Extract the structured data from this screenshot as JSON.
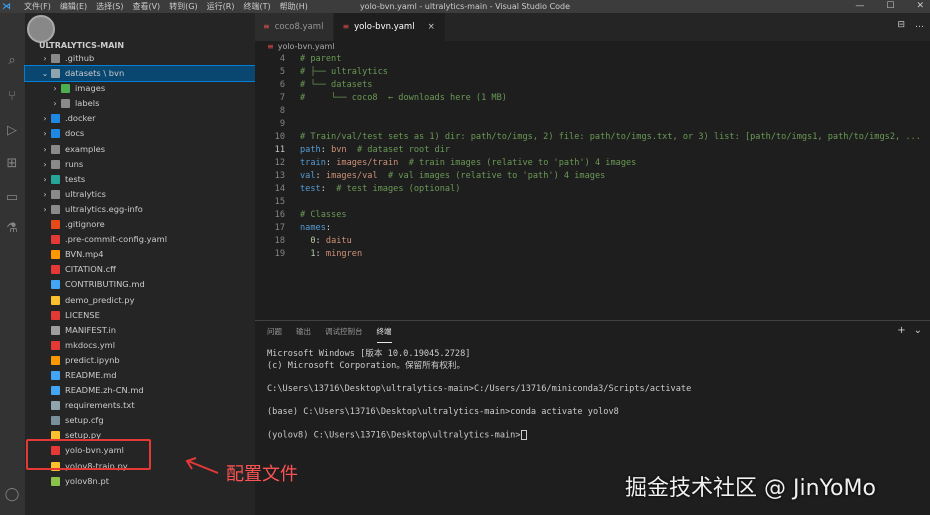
{
  "titlebar": {
    "menu": [
      "文件(F)",
      "编辑(E)",
      "选择(S)",
      "查看(V)",
      "转到(G)",
      "运行(R)",
      "终端(T)",
      "帮助(H)"
    ],
    "title": "yolo-bvn.yaml - ultralytics-main - Visual Studio Code",
    "min": "—",
    "max": "☐",
    "close": "✕"
  },
  "sidebar": {
    "title": "ULTRALYTICS-MAIN",
    "items": [
      {
        "label": ".github",
        "chev": "›",
        "icon": "#8a8a8a",
        "indent": 0
      },
      {
        "label": "datasets \\ bvn",
        "chev": "⌄",
        "icon": "#90a4ae",
        "indent": 0
      },
      {
        "label": "images",
        "chev": "›",
        "icon": "#4caf50",
        "indent": 1
      },
      {
        "label": "labels",
        "chev": "›",
        "icon": "#8a8a8a",
        "indent": 1
      },
      {
        "label": ".docker",
        "chev": "›",
        "icon": "#1e88e5",
        "indent": 0
      },
      {
        "label": "docs",
        "chev": "›",
        "icon": "#1e88e5",
        "indent": 0
      },
      {
        "label": "examples",
        "chev": "›",
        "icon": "#8a8a8a",
        "indent": 0
      },
      {
        "label": "runs",
        "chev": "›",
        "icon": "#8a8a8a",
        "indent": 0
      },
      {
        "label": "tests",
        "chev": "›",
        "icon": "#26a69a",
        "indent": 0
      },
      {
        "label": "ultralytics",
        "chev": "›",
        "icon": "#8a8a8a",
        "indent": 0
      },
      {
        "label": "ultralytics.egg-info",
        "chev": "›",
        "icon": "#8a8a8a",
        "indent": 0
      },
      {
        "label": ".gitignore",
        "chev": "",
        "icon": "#e64a19",
        "indent": 0
      },
      {
        "label": ".pre-commit-config.yaml",
        "chev": "",
        "icon": "#e53935",
        "indent": 0
      },
      {
        "label": "BVN.mp4",
        "chev": "",
        "icon": "#ff9800",
        "indent": 0
      },
      {
        "label": "CITATION.cff",
        "chev": "",
        "icon": "#e53935",
        "indent": 0
      },
      {
        "label": "CONTRIBUTING.md",
        "chev": "",
        "icon": "#42a5f5",
        "indent": 0
      },
      {
        "label": "demo_predict.py",
        "chev": "",
        "icon": "#fbc02d",
        "indent": 0
      },
      {
        "label": "LICENSE",
        "chev": "",
        "icon": "#e53935",
        "indent": 0
      },
      {
        "label": "MANIFEST.in",
        "chev": "",
        "icon": "#9e9e9e",
        "indent": 0
      },
      {
        "label": "mkdocs.yml",
        "chev": "",
        "icon": "#e53935",
        "indent": 0
      },
      {
        "label": "predict.ipynb",
        "chev": "",
        "icon": "#ff9800",
        "indent": 0
      },
      {
        "label": "README.md",
        "chev": "",
        "icon": "#42a5f5",
        "indent": 0
      },
      {
        "label": "README.zh-CN.md",
        "chev": "",
        "icon": "#42a5f5",
        "indent": 0
      },
      {
        "label": "requirements.txt",
        "chev": "",
        "icon": "#90a4ae",
        "indent": 0
      },
      {
        "label": "setup.cfg",
        "chev": "",
        "icon": "#78909c",
        "indent": 0
      },
      {
        "label": "setup.py",
        "chev": "",
        "icon": "#fbc02d",
        "indent": 0
      },
      {
        "label": "yolo-bvn.yaml",
        "chev": "",
        "icon": "#e53935",
        "indent": 0
      },
      {
        "label": "yolov8-train.py",
        "chev": "",
        "icon": "#fbc02d",
        "indent": 0
      },
      {
        "label": "yolov8n.pt",
        "chev": "",
        "icon": "#8bc34a",
        "indent": 0
      }
    ]
  },
  "tabs": [
    {
      "label": "coco8.yaml",
      "active": false
    },
    {
      "label": "yolo-bvn.yaml",
      "active": true
    }
  ],
  "tab_close": "×",
  "breadcrumb": "yolo-bvn.yaml",
  "editor_actions": [
    "⊟",
    "…"
  ],
  "code": [
    {
      "ln": "4",
      "parts": [
        [
          "c-com",
          "# parent"
        ]
      ]
    },
    {
      "ln": "5",
      "parts": [
        [
          "c-com",
          "# ├── ultralytics"
        ]
      ]
    },
    {
      "ln": "6",
      "parts": [
        [
          "c-com",
          "# └── datasets"
        ]
      ]
    },
    {
      "ln": "7",
      "parts": [
        [
          "c-com",
          "#     └── coco8  ← downloads here (1 MB)"
        ]
      ]
    },
    {
      "ln": "8",
      "parts": []
    },
    {
      "ln": "9",
      "parts": []
    },
    {
      "ln": "10",
      "parts": [
        [
          "c-com",
          "# Train/val/test sets as 1) dir: path/to/imgs, 2) file: path/to/imgs.txt, or 3) list: [path/to/imgs1, path/to/imgs2, ..."
        ]
      ]
    },
    {
      "ln": "11",
      "parts": [
        [
          "c-key",
          "path"
        ],
        [
          "c-txt",
          ": "
        ],
        [
          "c-str",
          "bvn"
        ],
        [
          "c-txt",
          "  "
        ],
        [
          "c-com",
          "# dataset root dir"
        ]
      ],
      "cur": true
    },
    {
      "ln": "12",
      "parts": [
        [
          "c-key",
          "train"
        ],
        [
          "c-txt",
          ": "
        ],
        [
          "c-str",
          "images/train"
        ],
        [
          "c-txt",
          "  "
        ],
        [
          "c-com",
          "# train images (relative to 'path') 4 images"
        ]
      ]
    },
    {
      "ln": "13",
      "parts": [
        [
          "c-key",
          "val"
        ],
        [
          "c-txt",
          ": "
        ],
        [
          "c-str",
          "images/val"
        ],
        [
          "c-txt",
          "  "
        ],
        [
          "c-com",
          "# val images (relative to 'path') 4 images"
        ]
      ]
    },
    {
      "ln": "14",
      "parts": [
        [
          "c-key",
          "test"
        ],
        [
          "c-txt",
          ":  "
        ],
        [
          "c-com",
          "# test images (optional)"
        ]
      ]
    },
    {
      "ln": "15",
      "parts": []
    },
    {
      "ln": "16",
      "parts": [
        [
          "c-com",
          "# Classes"
        ]
      ]
    },
    {
      "ln": "17",
      "parts": [
        [
          "c-key",
          "names"
        ],
        [
          "c-txt",
          ":"
        ]
      ]
    },
    {
      "ln": "18",
      "parts": [
        [
          "c-txt",
          "  "
        ],
        [
          "c-num",
          "0"
        ],
        [
          "c-txt",
          ": "
        ],
        [
          "c-str",
          "daitu"
        ]
      ]
    },
    {
      "ln": "19",
      "parts": [
        [
          "c-txt",
          "  "
        ],
        [
          "c-num",
          "1"
        ],
        [
          "c-txt",
          ": "
        ],
        [
          "c-str",
          "mingren"
        ]
      ]
    }
  ],
  "panel": {
    "tabs": [
      {
        "label": "问题",
        "active": false
      },
      {
        "label": "输出",
        "active": false
      },
      {
        "label": "调试控制台",
        "active": false
      },
      {
        "label": "终端",
        "active": true
      }
    ],
    "actions": [
      "+",
      "⌄"
    ],
    "terminal": [
      "Microsoft Windows [版本 10.0.19045.2728]",
      "(c) Microsoft Corporation。保留所有权利。",
      "",
      "C:\\Users\\13716\\Desktop\\ultralytics-main>C:/Users/13716/miniconda3/Scripts/activate",
      "",
      "(base) C:\\Users\\13716\\Desktop\\ultralytics-main>conda activate yolov8",
      "",
      "(yolov8) C:\\Users\\13716\\Desktop\\ultralytics-main>"
    ]
  },
  "annotation": "配置文件",
  "watermark": "掘金技术社区 @ JinYoMo",
  "colors": {
    "accent": "#007fd4",
    "annotation_red": "#e53935"
  }
}
